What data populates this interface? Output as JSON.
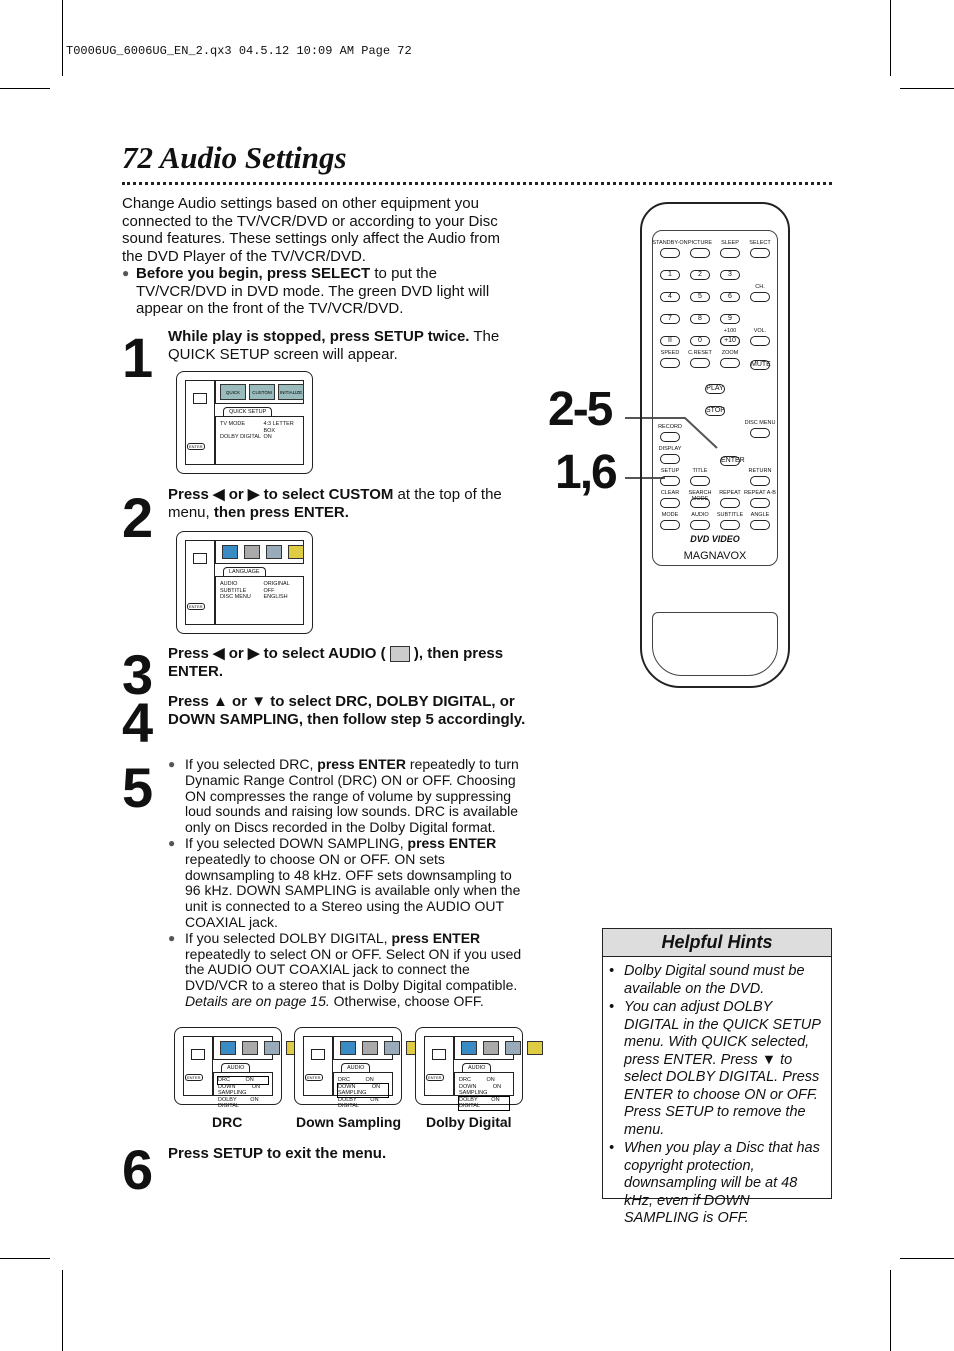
{
  "header": {
    "slug": "T0006UG_6006UG_EN_2.qx3  04.5.12  10:09 AM  Page 72"
  },
  "page": {
    "number": "72",
    "title": "Audio Settings"
  },
  "intro": {
    "text": "Change Audio settings based on other equipment you connected to the TV/VCR/DVD or according to your Disc sound features.  These settings only affect the Audio from the DVD Player of the TV/VCR/DVD.",
    "before_bold": "Before you begin, press SELECT",
    "before_rest": " to put the TV/VCR/DVD in DVD mode.  The green DVD light will appear on the front of the TV/VCR/DVD."
  },
  "steps": [
    {
      "num": "1",
      "bold": "While play is stopped, press SETUP twice.",
      "rest": " The QUICK SETUP screen will appear."
    },
    {
      "num": "2",
      "bold": "Press ◀ or ▶ to select CUSTOM",
      "rest": " at the top of the menu, ",
      "bold2": "then press ENTER."
    },
    {
      "num": "3",
      "bold": "Press ◀ or ▶ to select AUDIO (",
      "bold2": "), then press ENTER."
    },
    {
      "num": "4",
      "bold": "Press ▲ or ▼ to select DRC, DOLBY DIGITAL, or DOWN SAMPLING, then follow step 5 accordingly."
    },
    {
      "num": "5",
      "bullets": [
        {
          "a": "If you selected DRC, ",
          "b": "press ENTER",
          "c": " repeatedly to turn Dynamic Range Control (DRC) ON or OFF. Choosing ON compresses the range of volume by suppressing loud sounds and raising low sounds. DRC is available only on Discs recorded in the Dolby Digital format."
        },
        {
          "a": "If you selected DOWN SAMPLING, ",
          "b": "press ENTER",
          "c": " repeatedly to choose ON or OFF. ON sets downsampling to 48 kHz. OFF sets downsampling to 96 kHz. DOWN SAMPLING is available only when the unit is connected to a Stereo using the AUDIO OUT COAXIAL jack."
        },
        {
          "a": "If you selected DOLBY DIGITAL, ",
          "b": "press ENTER",
          "c": " repeatedly to select ON or OFF.  Select ON if you used the AUDIO OUT COAXIAL jack to connect the DVD/VCR to a stereo that is Dolby Digital compatible. ",
          "i": "Details are on page 15.",
          "d": " Otherwise, choose OFF."
        }
      ]
    },
    {
      "num": "6",
      "bold": "Press SETUP to exit the menu."
    }
  ],
  "screens": {
    "quick": {
      "tab": "QUICK SETUP",
      "icons": [
        "QUICK",
        "CUSTOM",
        "INITIALIZE"
      ],
      "rows": [
        [
          "TV MODE",
          "4:3 LETTER BOX"
        ],
        [
          "DOLBY DIGITAL",
          "ON"
        ]
      ]
    },
    "language": {
      "tab": "LANGUAGE",
      "rows": [
        [
          "AUDIO",
          "ORIGINAL"
        ],
        [
          "SUBTITLE",
          "OFF"
        ],
        [
          "DISC MENU",
          "ENGLISH"
        ]
      ]
    },
    "audio": {
      "tab": "AUDIO",
      "rows": [
        [
          "DRC",
          "ON"
        ],
        [
          "DOWN SAMPLING",
          "ON"
        ],
        [
          "DOLBY DIGITAL",
          "ON"
        ]
      ]
    },
    "enter_label": "ENTER",
    "captions": [
      "DRC",
      "Down Sampling",
      "Dolby Digital"
    ]
  },
  "callouts": {
    "a": "2-5",
    "b": "1,6"
  },
  "hints": {
    "title": "Helpful Hints",
    "items": [
      "Dolby Digital sound must be available on the DVD.",
      "You can adjust DOLBY DIGITAL in the QUICK SETUP menu. With QUICK selected, press ENTER. Press ▼ to select DOLBY DIGITAL. Press ENTER to choose ON or OFF. Press SETUP to remove the menu.",
      "When you play a Disc that has copyright protection, downsampling will be at 48 kHz, even if DOWN SAMPLING is OFF."
    ]
  },
  "remote": {
    "brand": "MAGNAVOX",
    "logo": "DVD VIDEO",
    "labels": [
      "STANDBY-ON",
      "PICTURE",
      "SLEEP",
      "SELECT",
      "1",
      "2",
      "3",
      "CH.",
      "4",
      "5",
      "6",
      "7",
      "8",
      "9",
      "VOL.",
      "II",
      "0",
      "+10",
      "+100",
      "SPEED",
      "C.RESET",
      "ZOOM",
      "MUTE",
      "PLAY",
      "STOP",
      "RECORD",
      "DISC MENU",
      "DISPLAY",
      "ENTER",
      "SETUP",
      "TITLE",
      "RETURN",
      "CLEAR",
      "SEARCH MODE",
      "REPEAT",
      "REPEAT A-B",
      "MODE",
      "AUDIO",
      "SUBTITLE",
      "ANGLE"
    ]
  }
}
